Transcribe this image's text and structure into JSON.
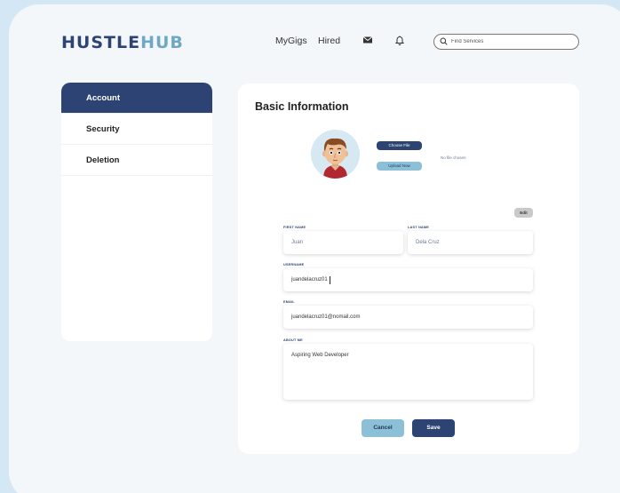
{
  "brand": {
    "logo_main": "HUSTLE",
    "logo_accent": "HUB"
  },
  "nav": {
    "mygigs": "MyGigs",
    "hired": "Hired"
  },
  "search": {
    "placeholder": "Find Services"
  },
  "sidebar": {
    "items": [
      {
        "label": "Account"
      },
      {
        "label": "Security"
      },
      {
        "label": "Deletion"
      }
    ]
  },
  "profile": {
    "title": "Basic Information",
    "choose_file": "Choose File",
    "upload_now": "Upload Now",
    "no_file": "No file chosen",
    "edit": "Edit",
    "first_name_label": "FIRST NAME",
    "first_name": "Juan",
    "last_name_label": "LAST NAME",
    "last_name": "Dela Cruz",
    "username_label": "USERNAME",
    "username": "juandelacruz01",
    "email_label": "EMAIL",
    "email": "juandelacruz01@nomail.com",
    "about_label": "ABOUT ME",
    "about": "Aspiring Web Developer",
    "cancel": "Cancel",
    "save": "Save"
  },
  "colors": {
    "primary": "#2d4373",
    "accent": "#8cc0d6",
    "background": "#d3e8f4"
  },
  "icons": {
    "mail": "mail-icon",
    "bell": "bell-icon",
    "search": "search-icon"
  }
}
